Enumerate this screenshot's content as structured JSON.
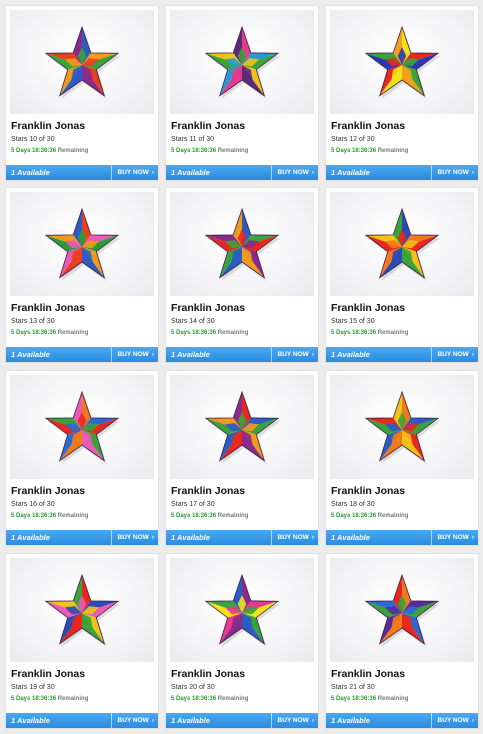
{
  "products": [
    {
      "artist": "Franklin Jonas",
      "edition": "Stars 10 of 30",
      "time": "5 Days 18:36:36",
      "remaining": "Remaining",
      "availability": "1 Available",
      "buy": "BUY NOW",
      "palette": [
        "#2a5cc4",
        "#f29a1a",
        "#3aa33a",
        "#e8401c",
        "#8a2a8a"
      ]
    },
    {
      "artist": "Franklin Jonas",
      "edition": "Stars 11 of 30",
      "time": "5 Days 18:36:36",
      "remaining": "Remaining",
      "availability": "1 Available",
      "buy": "BUY NOW",
      "palette": [
        "#e83a8a",
        "#2a9ad4",
        "#3aa33a",
        "#f2c21a",
        "#5a2a7a"
      ]
    },
    {
      "artist": "Franklin Jonas",
      "edition": "Stars 12 of 30",
      "time": "5 Days 18:36:36",
      "remaining": "Remaining",
      "availability": "1 Available",
      "buy": "BUY NOW",
      "palette": [
        "#f2e21a",
        "#e8281c",
        "#2a3ab4",
        "#3aa33a",
        "#f2a21a"
      ]
    },
    {
      "artist": "Franklin Jonas",
      "edition": "Stars 13 of 30",
      "time": "5 Days 18:36:36",
      "remaining": "Remaining",
      "availability": "1 Available",
      "buy": "BUY NOW",
      "palette": [
        "#e8401c",
        "#e85ab4",
        "#2a9a3a",
        "#f29a1a",
        "#2a5cc4"
      ]
    },
    {
      "artist": "Franklin Jonas",
      "edition": "Stars 14 of 30",
      "time": "5 Days 18:36:36",
      "remaining": "Remaining",
      "availability": "1 Available",
      "buy": "BUY NOW",
      "palette": [
        "#2a5cc4",
        "#3aa33a",
        "#e8281c",
        "#8a2a8a",
        "#f29a1a"
      ]
    },
    {
      "artist": "Franklin Jonas",
      "edition": "Stars 15 of 30",
      "time": "5 Days 18:36:36",
      "remaining": "Remaining",
      "availability": "1 Available",
      "buy": "BUY NOW",
      "palette": [
        "#2a4ab4",
        "#f27a1a",
        "#e8281c",
        "#f2c21a",
        "#3aa33a"
      ]
    },
    {
      "artist": "Franklin Jonas",
      "edition": "Stars 16 of 30",
      "time": "5 Days 18:36:36",
      "remaining": "Remaining",
      "availability": "1 Available",
      "buy": "BUY NOW",
      "palette": [
        "#f27a1a",
        "#2a6ad4",
        "#e8281c",
        "#3aa33a",
        "#e85ab4"
      ]
    },
    {
      "artist": "Franklin Jonas",
      "edition": "Stars 17 of 30",
      "time": "5 Days 18:36:36",
      "remaining": "Remaining",
      "availability": "1 Available",
      "buy": "BUY NOW",
      "palette": [
        "#e8281c",
        "#2a5cc4",
        "#3aa33a",
        "#f29a1a",
        "#8a2a8a"
      ]
    },
    {
      "artist": "Franklin Jonas",
      "edition": "Stars 18 of 30",
      "time": "5 Days 18:36:36",
      "remaining": "Remaining",
      "availability": "1 Available",
      "buy": "BUY NOW",
      "palette": [
        "#f27a1a",
        "#2a5cc4",
        "#3aa33a",
        "#e8281c",
        "#f2c21a"
      ]
    },
    {
      "artist": "Franklin Jonas",
      "edition": "Stars 19 of 30",
      "time": "5 Days 18:36:36",
      "remaining": "Remaining",
      "availability": "1 Available",
      "buy": "BUY NOW",
      "palette": [
        "#e8281c",
        "#2a4ab4",
        "#e85ab4",
        "#f2c21a",
        "#3aa33a"
      ]
    },
    {
      "artist": "Franklin Jonas",
      "edition": "Stars 20 of 30",
      "time": "5 Days 18:36:36",
      "remaining": "Remaining",
      "availability": "1 Available",
      "buy": "BUY NOW",
      "palette": [
        "#8a2a8a",
        "#e83a8a",
        "#f2e21a",
        "#3aa33a",
        "#2a5cc4"
      ]
    },
    {
      "artist": "Franklin Jonas",
      "edition": "Stars 21 of 30",
      "time": "5 Days 18:36:36",
      "remaining": "Remaining",
      "availability": "1 Available",
      "buy": "BUY NOW",
      "palette": [
        "#f27a1a",
        "#5a2a9a",
        "#3aa33a",
        "#2a6ad4",
        "#e8281c"
      ]
    }
  ]
}
